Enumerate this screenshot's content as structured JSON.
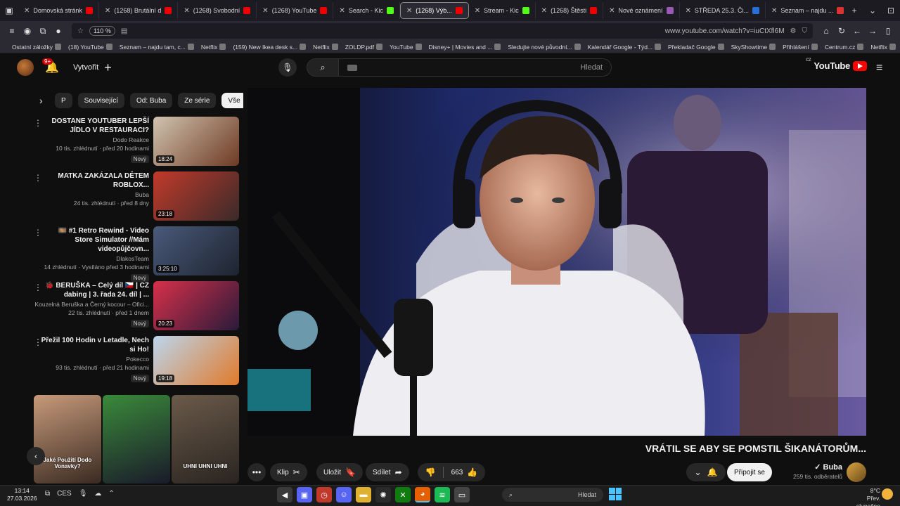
{
  "browser": {
    "tabs": [
      {
        "label": "Seznam – najdu ...",
        "color": "#d33"
      },
      {
        "label": "STŘEDA 25.3. Či...",
        "color": "#2a6fd6"
      },
      {
        "label": "Nové oznámení",
        "color": "#9b59b6"
      },
      {
        "label": "(1268) Štěsti",
        "color": "#e00"
      },
      {
        "label": "Stream - Kic",
        "color": "#53fc18"
      },
      {
        "label": "(1268) Výb...",
        "color": "#e00",
        "active": true
      },
      {
        "label": "Search - Kic",
        "color": "#53fc18"
      },
      {
        "label": "(1268) YouTube",
        "color": "#e00"
      },
      {
        "label": "(1268) Svobodní",
        "color": "#e00"
      },
      {
        "label": "(1268) Brutální d",
        "color": "#e00"
      },
      {
        "label": "Domovská stránk",
        "color": "#e00"
      }
    ],
    "url": "www.youtube.com/watch?v=iuCtXfl6M",
    "zoom": "110 %",
    "bookmarks": [
      "Netflix",
      "Centrum.cz",
      "Přihlášení",
      "SkyShowtime",
      "Překladač Google",
      "Kalendář Google - Týd...",
      "Sledujte nové původní...",
      "Disney+ | Movies and ...",
      "YouTube",
      "ZOLDP.pdf",
      "Netflix",
      "(159) New Ikea desk s...",
      "Netflix",
      "Seznam – najdu tam, c...",
      "(18) YouTube",
      "Ostatní záložky"
    ]
  },
  "yt": {
    "logo_text": "YouTube",
    "logo_region": "CZ",
    "search_placeholder": "Hledat",
    "create_label": "Vytvořit",
    "notif_count": "9+",
    "chips": [
      "Vše",
      "Ze série",
      "Od: Buba",
      "Související",
      "P"
    ],
    "recommendations": [
      {
        "title": "DOSTANE YOUTUBER LEPŠÍ JÍDLO V RESTAURACI?",
        "channel": "Dodo Reakce",
        "stats": "10 tis. zhlédnutí · před 20 hodinami",
        "badge": "Nový",
        "duration": "18:24",
        "colors": [
          "#d0c3b0",
          "#6e3a22"
        ]
      },
      {
        "title": "MATKA ZAKÁZALA DĚTEM ROBLOX...",
        "channel": "Buba",
        "stats": "24 tis. zhlédnutí · před 8 dny",
        "badge": "",
        "duration": "23:18",
        "colors": [
          "#c23a2a",
          "#3a2a2a"
        ]
      },
      {
        "title": "🎞️ #1 Retro Rewind - Video Store Simulator //Mám videopůjčovn...",
        "channel": "DlakosTeam",
        "stats": "14 zhlédnutí · Vysíláno před 3 hodinami",
        "badge": "Nový",
        "duration": "3:25:10",
        "colors": [
          "#4a5a7a",
          "#1e2430"
        ]
      },
      {
        "title": "🐞 BERUŠKA – Celý díl 🇨🇿 | CZ dabing | 3. řada 24. díl | ...",
        "channel": "Kouzelná Beruška a Černý kocour – Ofici...",
        "stats": "22 tis. zhlédnutí · před 1 dnem",
        "badge": "Nový",
        "duration": "20:23",
        "colors": [
          "#d8304a",
          "#2a1a3a"
        ]
      },
      {
        "title": "Přežil 100 Hodin v Letadle, Nech si Ho!",
        "channel": "Pokecco",
        "stats": "93 tis. zhlédnutí · před 21 hodinami",
        "badge": "Nový",
        "duration": "19:18",
        "colors": [
          "#bcd6ee",
          "#e07a2a"
        ]
      }
    ],
    "shorts": [
      {
        "caption": "Jaké Použití Dodo Vonavky?",
        "colors": [
          "#c79a7a",
          "#3a2a22"
        ]
      },
      {
        "caption": "",
        "colors": [
          "#3a8a3a",
          "#1a1a2a"
        ]
      },
      {
        "caption": "UHNI UHNI UHNI",
        "colors": [
          "#6a5a4a",
          "#2a2420"
        ]
      }
    ],
    "video": {
      "title": "VRÁTIL SE ABY SE POMSTIL ŠIKANÁTORŮM...",
      "channel_name": "Buba",
      "subscribers": "259 tis. odběratelů",
      "subscribe_label": "Připojit se",
      "likes": "663",
      "share_label": "Sdílet",
      "save_label": "Uložit",
      "clip_label": "Klip"
    }
  },
  "taskbar": {
    "time": "13:14",
    "date": "27.03.2026",
    "lang": "CES",
    "search_placeholder": "Hledat",
    "weather_temp": "8°C",
    "weather_text": "Přev. slunečno"
  }
}
